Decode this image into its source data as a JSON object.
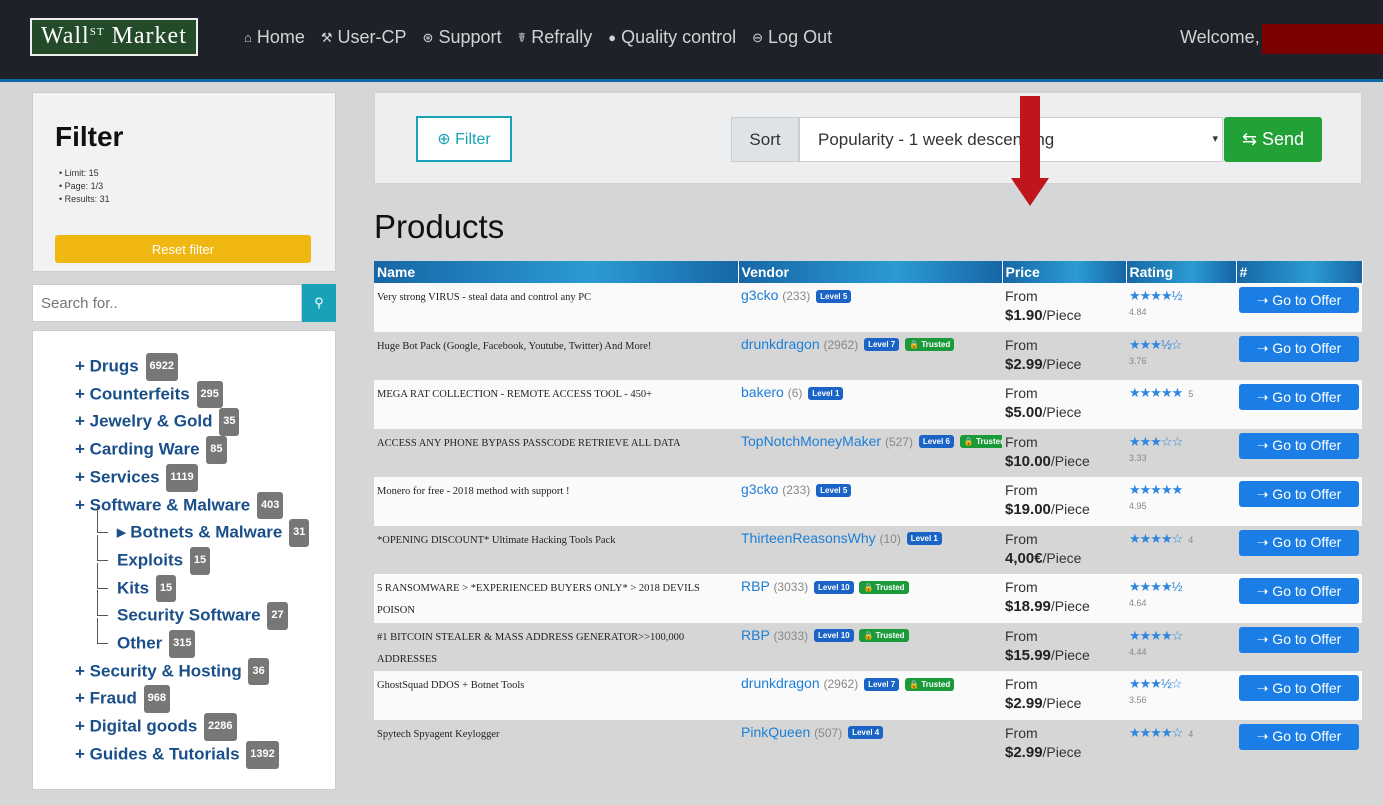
{
  "header": {
    "logo": "Wall",
    "logo_sup": "ST",
    "logo_tail": "Market",
    "nav": [
      {
        "icon": "⌂",
        "label": "Home"
      },
      {
        "icon": "⚒",
        "label": "User-CP"
      },
      {
        "icon": "⊛",
        "label": "Support"
      },
      {
        "icon": "☤",
        "label": "Refrally"
      },
      {
        "icon": "●",
        "label": "Quality control"
      },
      {
        "icon": "⊖",
        "label": "Log Out"
      }
    ],
    "welcome": "Welcome,"
  },
  "filter": {
    "title": "Filter",
    "stats": [
      "Limit: 15",
      "Page: 1/3",
      "Results: 31"
    ],
    "reset": "Reset filter"
  },
  "search": {
    "placeholder": "Search for..",
    "icon": "search-icon"
  },
  "categories": [
    {
      "label": "+ Drugs",
      "count": "6922"
    },
    {
      "label": "+ Counterfeits",
      "count": "295"
    },
    {
      "label": "+ Jewelry & Gold",
      "count": "35"
    },
    {
      "label": "+ Carding Ware",
      "count": "85"
    },
    {
      "label": "+ Services",
      "count": "1119"
    },
    {
      "label": "+ Software & Malware",
      "count": "403"
    },
    {
      "label": "▸ Botnets & Malware",
      "count": "31"
    },
    {
      "label": "Exploits",
      "count": "15"
    },
    {
      "label": "Kits",
      "count": "15"
    },
    {
      "label": "Security Software",
      "count": "27"
    },
    {
      "label": "Other",
      "count": "315"
    },
    {
      "label": "+ Security & Hosting",
      "count": "36"
    },
    {
      "label": "+ Fraud",
      "count": "968"
    },
    {
      "label": "+ Digital goods",
      "count": "2286"
    },
    {
      "label": "+ Guides & Tutorials",
      "count": "1392"
    }
  ],
  "toolbar": {
    "filter_btn": "⊕ Filter",
    "sort_label": "Sort",
    "sort_value": "Popularity - 1 week descending",
    "send": "⇆ Send"
  },
  "products_title": "Products",
  "table": {
    "headers": [
      "Name",
      "Vendor",
      "Price",
      "Rating",
      "#"
    ],
    "rows": [
      {
        "name": "Very strong VIRUS - steal data and control any PC",
        "vendor": "g3cko",
        "vcount": "(233)",
        "level": "Level 5",
        "trusted": "",
        "price_from": "From",
        "price": "$1.90",
        "unit": "/Piece",
        "stars": "★★★★½",
        "rating": "4.84"
      },
      {
        "name": "Huge Bot Pack (Google, Facebook, Youtube, Twitter) And More!",
        "vendor": "drunkdragon",
        "vcount": "(2962)",
        "level": "Level 7",
        "trusted": "Trusted",
        "price_from": "From",
        "price": "$2.99",
        "unit": "/Piece",
        "stars": "★★★½☆",
        "rating": "3.76"
      },
      {
        "name": "MEGA RAT COLLECTION - REMOTE ACCESS TOOL - 450+",
        "vendor": "bakero",
        "vcount": "(6)",
        "level": "Level 1",
        "trusted": "",
        "price_from": "From",
        "price": "$5.00",
        "unit": "/Piece",
        "stars": "★★★★★",
        "rating": "5"
      },
      {
        "name": "ACCESS ANY PHONE BYPASS PASSCODE RETRIEVE ALL DATA",
        "vendor": "TopNotchMoneyMaker",
        "vcount": "(527)",
        "level": "Level 6",
        "trusted": "Trusted",
        "price_from": "From",
        "price": "$10.00",
        "unit": "/Piece",
        "stars": "★★★☆☆",
        "rating": "3.33"
      },
      {
        "name": "Monero for free - 2018 method with support !",
        "vendor": "g3cko",
        "vcount": "(233)",
        "level": "Level 5",
        "trusted": "",
        "price_from": "From",
        "price": "$19.00",
        "unit": "/Piece",
        "stars": "★★★★★",
        "rating": "4.95"
      },
      {
        "name": "*OPENING DISCOUNT* Ultimate Hacking Tools Pack",
        "vendor": "ThirteenReasonsWhy",
        "vcount": "(10)",
        "level": "Level 1",
        "trusted": "",
        "price_from": "From",
        "price": "4,00€",
        "unit": "/Piece",
        "stars": "★★★★☆",
        "rating": "4"
      },
      {
        "name": "5 RANSOMWARE > *EXPERIENCED BUYERS ONLY* > 2018 DEVILS POISON",
        "vendor": "RBP",
        "vcount": "(3033)",
        "level": "Level 10",
        "trusted": "Trusted",
        "price_from": "From",
        "price": "$18.99",
        "unit": "/Piece",
        "stars": "★★★★½",
        "rating": "4.64"
      },
      {
        "name": "#1 BITCOIN STEALER & MASS ADDRESS GENERATOR>>100,000 ADDRESSES",
        "vendor": "RBP",
        "vcount": "(3033)",
        "level": "Level 10",
        "trusted": "Trusted",
        "price_from": "From",
        "price": "$15.99",
        "unit": "/Piece",
        "stars": "★★★★☆",
        "rating": "4.44"
      },
      {
        "name": "GhostSquad DDOS + Botnet Tools",
        "vendor": "drunkdragon",
        "vcount": "(2962)",
        "level": "Level 7",
        "trusted": "Trusted",
        "price_from": "From",
        "price": "$2.99",
        "unit": "/Piece",
        "stars": "★★★½☆",
        "rating": "3.56"
      },
      {
        "name": "Spytech Spyagent Keylogger",
        "vendor": "PinkQueen",
        "vcount": "(507)",
        "level": "Level 4",
        "trusted": "",
        "price_from": "From",
        "price": "$2.99",
        "unit": "/Piece",
        "stars": "★★★★☆",
        "rating": "4"
      }
    ],
    "offer_label": "➝ Go to Offer"
  },
  "colors": {
    "accent": "#1b7ee6",
    "arrow": "#c0161b",
    "send": "#21a136",
    "reset": "#f0b710"
  }
}
